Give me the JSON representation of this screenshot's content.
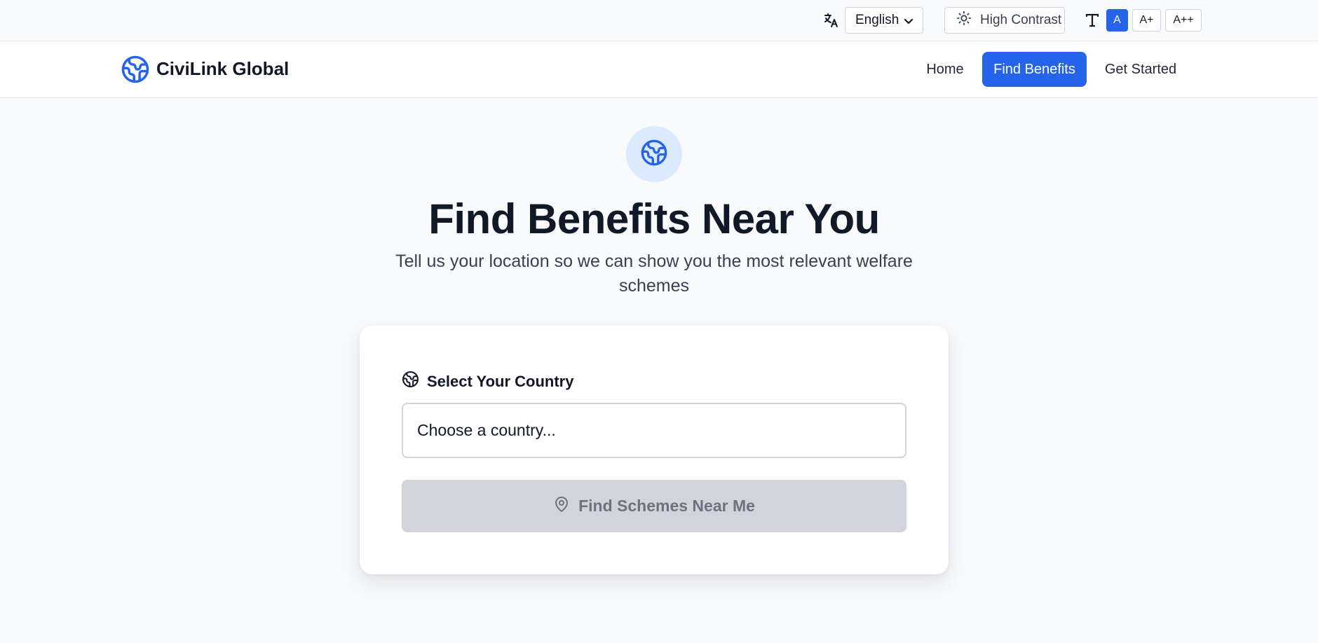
{
  "utility": {
    "language_icon": "translate-icon",
    "language_value": "English",
    "contrast_icon": "sun-icon",
    "contrast_label": "High Contrast",
    "textsize_icon": "text-size-icon",
    "font_sizes": [
      "A",
      "A+",
      "A++"
    ],
    "active_font_size": "A"
  },
  "nav": {
    "logo_icon": "globe-icon",
    "brand": "CiviLink Global",
    "links": [
      "Home",
      "Find Benefits",
      "Get Started"
    ],
    "active_link": "Find Benefits"
  },
  "hero": {
    "icon": "globe-icon",
    "title": "Find Benefits Near You",
    "subtitle": "Tell us your location so we can show you the most relevant welfare schemes"
  },
  "form": {
    "label_icon": "globe-icon",
    "label": "Select Your Country",
    "select_value": "Choose a country...",
    "button_icon": "map-pin-icon",
    "button_label": "Find Schemes Near Me",
    "button_state": "disabled"
  },
  "colors": {
    "accent": "#2563eb",
    "accent_light": "#dbeafe",
    "disabled_bg": "#d1d5db",
    "disabled_text": "#6b7280",
    "page_bg": "#f8fafc"
  }
}
